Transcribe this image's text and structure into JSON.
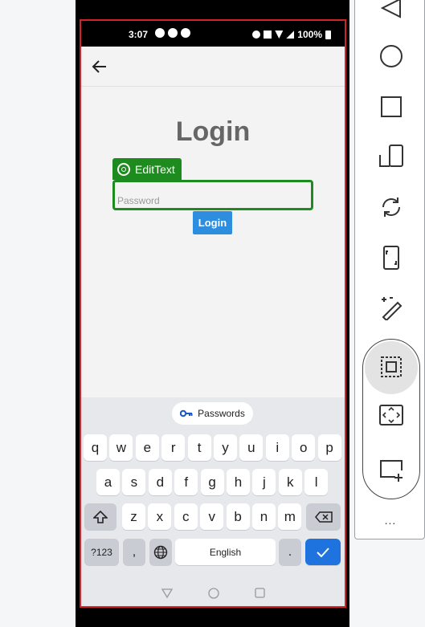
{
  "status_bar": {
    "time": "3:07",
    "battery": "100%"
  },
  "screen": {
    "title": "Login",
    "password_placeholder": "Password",
    "login_label": "Login"
  },
  "inspector": {
    "element_type": "EditText",
    "highlight_color": "#1e8b1e"
  },
  "keyboard": {
    "suggestion_chip": "Passwords",
    "row1": [
      "q",
      "w",
      "e",
      "r",
      "t",
      "y",
      "u",
      "i",
      "o",
      "p"
    ],
    "row2": [
      "a",
      "s",
      "d",
      "f",
      "g",
      "h",
      "j",
      "k",
      "l"
    ],
    "row3": [
      "z",
      "x",
      "c",
      "v",
      "b",
      "n",
      "m"
    ],
    "symbols_label": "?123",
    "comma_label": ",",
    "space_label": "English",
    "period_label": "."
  },
  "colors": {
    "accent": "#2d8ee0",
    "enter": "#1f73de",
    "frame_outline": "#d2232a"
  },
  "emulator_toolbar": {
    "items": [
      "back-icon",
      "home-icon",
      "overview-icon",
      "rotate-device-icon",
      "rotate-screen-icon",
      "fold-icon",
      "edit-icon",
      "select-area-icon",
      "fit-screen-icon",
      "add-display-icon"
    ],
    "more_label": "..."
  }
}
